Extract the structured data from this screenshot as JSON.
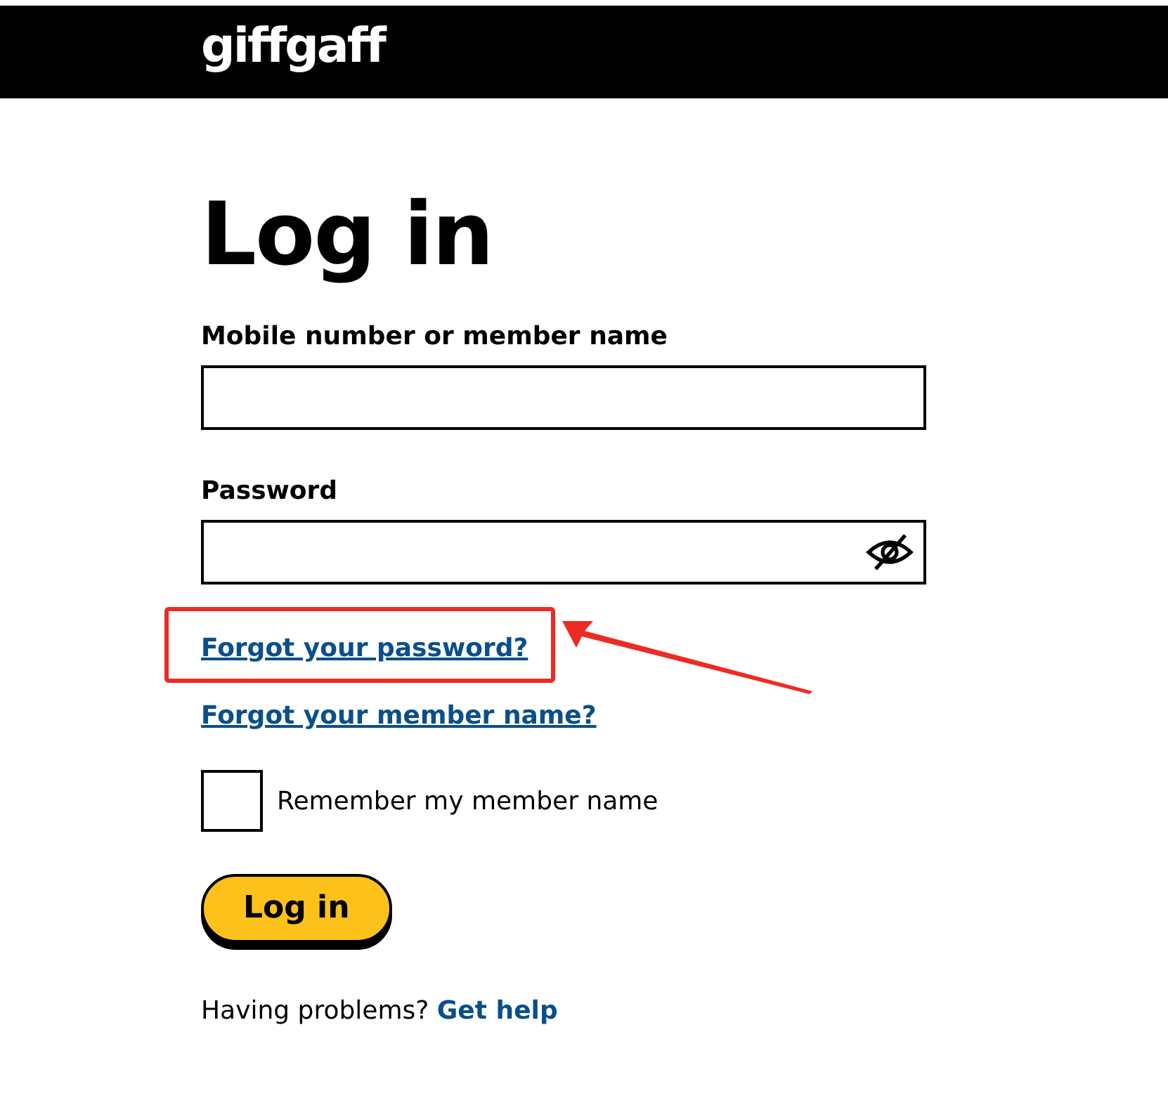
{
  "header": {
    "logo": "giffgaff"
  },
  "title": "Log in",
  "fields": [
    {
      "label": "Mobile number or member name",
      "kind": "text"
    },
    {
      "label": "Password",
      "kind": "password"
    }
  ],
  "links": [
    {
      "label": "Forgot your password?",
      "highlighted": true
    },
    {
      "label": "Forgot your member name?",
      "highlighted": false
    }
  ],
  "remember": {
    "label": "Remember my member name",
    "checked": false
  },
  "submit": "Log in",
  "help": {
    "text": "Having problems?",
    "link": "Get help"
  }
}
